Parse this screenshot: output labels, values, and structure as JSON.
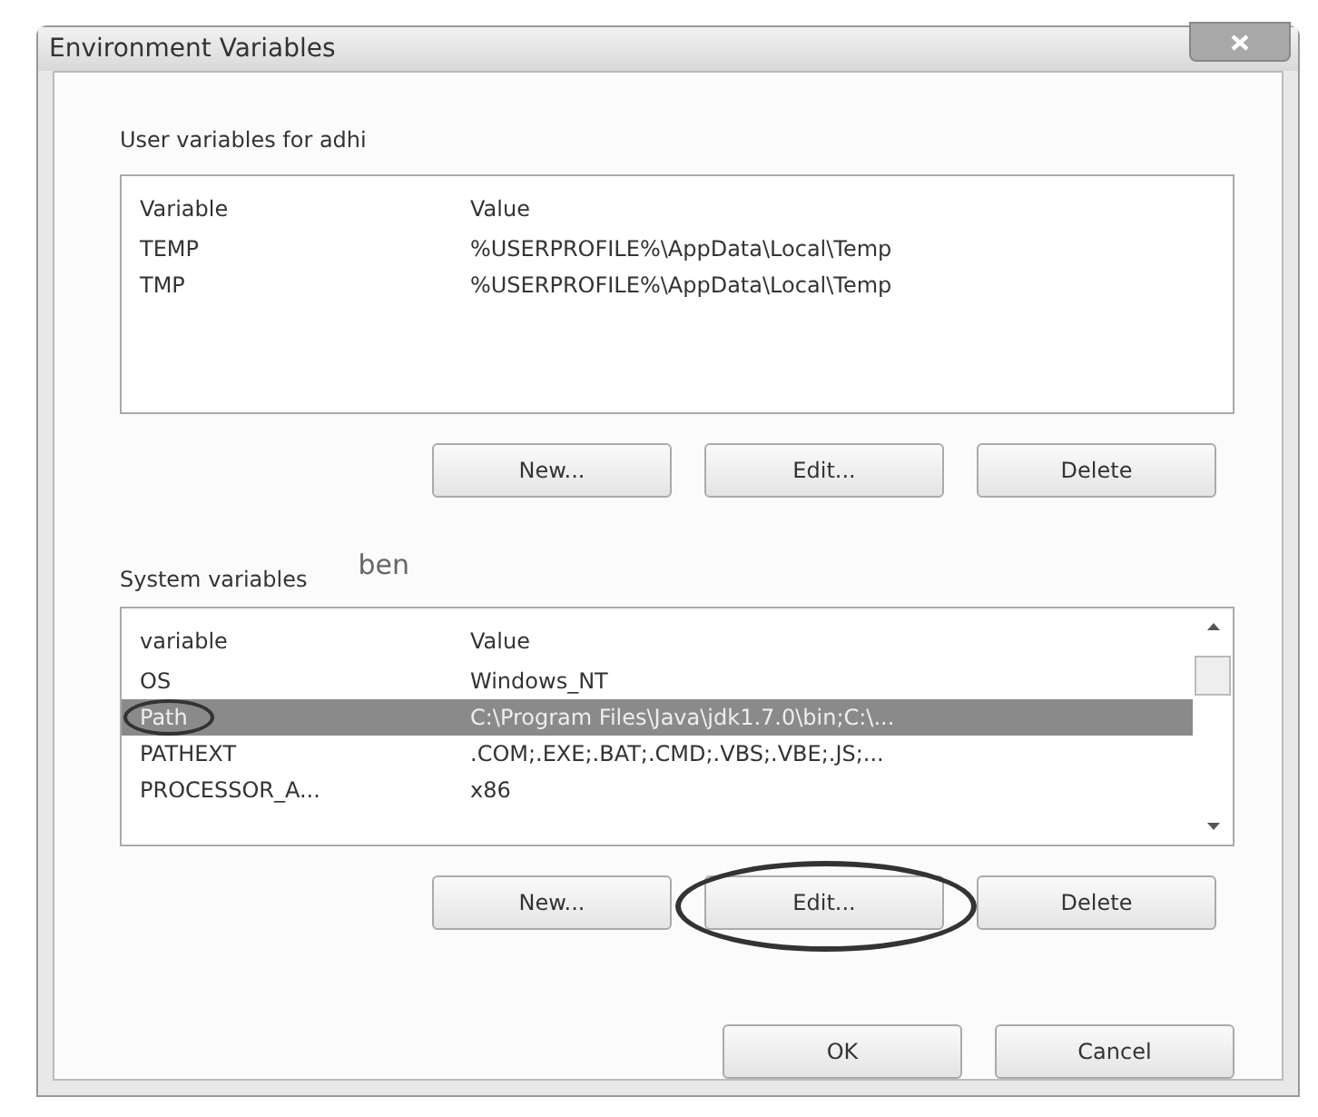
{
  "window": {
    "title": "Environment Variables"
  },
  "user_variables": {
    "label": "User variables for adhi",
    "columns": [
      "Variable",
      "Value"
    ],
    "rows": [
      {
        "variable": "TEMP",
        "value": "%USERPROFILE%\\AppData\\Local\\Temp",
        "selected": false,
        "circled": false
      },
      {
        "variable": "TMP",
        "value": "%USERPROFILE%\\AppData\\Local\\Temp",
        "selected": false,
        "circled": false
      }
    ],
    "buttons": [
      {
        "label": "New...",
        "circled": false
      },
      {
        "label": "Edit...",
        "circled": false
      },
      {
        "label": "Delete",
        "circled": false
      }
    ]
  },
  "handwritten_note": "ben",
  "system_variables": {
    "label": "System variables",
    "columns": [
      "variable",
      "Value"
    ],
    "rows": [
      {
        "variable": "OS",
        "value": "Windows_NT",
        "selected": false,
        "circled": false
      },
      {
        "variable": "Path",
        "value": "C:\\Program Files\\Java\\jdk1.7.0\\bin;C:\\...",
        "selected": true,
        "circled": true
      },
      {
        "variable": "PATHEXT",
        "value": ".COM;.EXE;.BAT;.CMD;.VBS;.VBE;.JS;...",
        "selected": false,
        "circled": false
      },
      {
        "variable": "PROCESSOR_A...",
        "value": "x86",
        "selected": false,
        "circled": false
      }
    ],
    "buttons": [
      {
        "label": "New...",
        "circled": false
      },
      {
        "label": "Edit...",
        "circled": true
      },
      {
        "label": "Delete",
        "circled": false
      }
    ]
  },
  "dialog_buttons": [
    "OK",
    "Cancel"
  ]
}
